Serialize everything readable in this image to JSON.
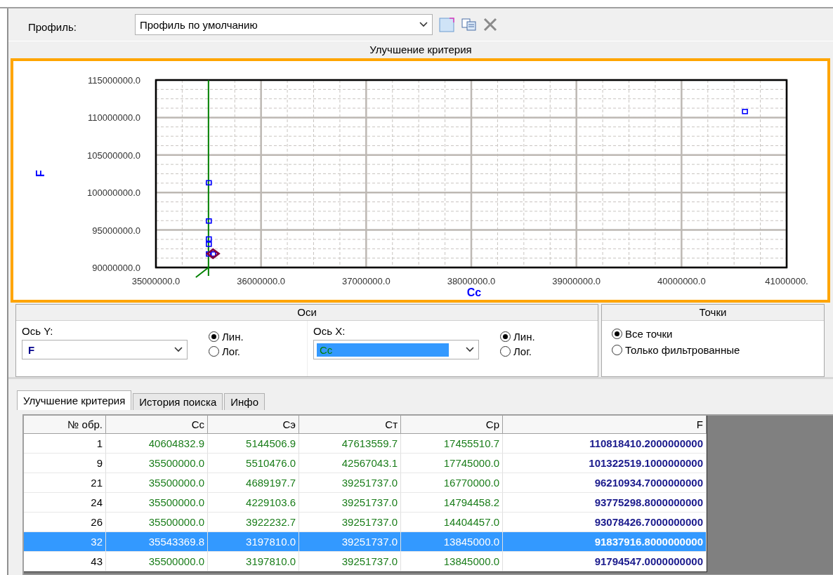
{
  "profile": {
    "label": "Профиль:",
    "value": "Профиль по умолчанию"
  },
  "chart_panel": {
    "title": "Улучшение критерия",
    "chart_data": {
      "type": "scatter",
      "xlabel": "Cc",
      "ylabel": "F",
      "xlim": [
        35000000,
        41000000
      ],
      "ylim": [
        90000000,
        115000000
      ],
      "xticks": [
        {
          "value": 35000000,
          "label": "35000000.0"
        },
        {
          "value": 36000000,
          "label": "36000000.0"
        },
        {
          "value": 37000000,
          "label": "37000000.0"
        },
        {
          "value": 38000000,
          "label": "38000000.0"
        },
        {
          "value": 39000000,
          "label": "39000000.0"
        },
        {
          "value": 40000000,
          "label": "40000000.0"
        },
        {
          "value": 41000000,
          "label": "41000000."
        }
      ],
      "yticks": [
        {
          "value": 90000000,
          "label": "90000000.0"
        },
        {
          "value": 95000000,
          "label": "95000000.0"
        },
        {
          "value": 100000000,
          "label": "100000000.0"
        },
        {
          "value": 105000000,
          "label": "105000000.0"
        },
        {
          "value": 110000000,
          "label": "110000000.0"
        },
        {
          "value": 115000000,
          "label": "115000000.0"
        }
      ],
      "series": [
        {
          "color": "#0000ff",
          "x": [
            40600000,
            35500000,
            35500000,
            35500000,
            35500000,
            35540000,
            35500000
          ],
          "values": [
            110800000,
            101300000,
            96200000,
            93800000,
            93100000,
            91800000,
            91800000
          ]
        }
      ],
      "grid": true,
      "ref_lines": [
        {
          "axis": "x",
          "value": 35500000
        }
      ]
    }
  },
  "axes_panel": {
    "title": "Оси",
    "axes": [
      {
        "label": "Ось Y:",
        "value": "F",
        "highlighted": false,
        "scales": [
          {
            "label": "Лин.",
            "selected": true
          },
          {
            "label": "Лог.",
            "selected": false
          }
        ]
      },
      {
        "label": "Ось X:",
        "value": "Cc",
        "highlighted": true,
        "scales": [
          {
            "label": "Лин.",
            "selected": true
          },
          {
            "label": "Лог.",
            "selected": false
          }
        ]
      }
    ]
  },
  "points_panel": {
    "title": "Точки",
    "options": [
      {
        "label": "Все точки",
        "selected": true
      },
      {
        "label": "Только фильтрованные",
        "selected": false
      }
    ]
  },
  "tabs": [
    {
      "label": "Улучшение критерия",
      "selected": true
    },
    {
      "label": "История поиска",
      "selected": false
    },
    {
      "label": "Инфо",
      "selected": false
    }
  ],
  "table": {
    "columns": [
      {
        "label": "№ обр.",
        "kind": "index"
      },
      {
        "label": "Cc",
        "kind": "param"
      },
      {
        "label": "Cэ",
        "kind": "param"
      },
      {
        "label": "Cт",
        "kind": "param"
      },
      {
        "label": "Cp",
        "kind": "param"
      },
      {
        "label": "F",
        "kind": "criterion"
      }
    ],
    "rows": [
      {
        "selected": false,
        "cells": [
          "1",
          "40604832.9",
          "5144506.9",
          "47613559.7",
          "17455510.7",
          "110818410.2000000000"
        ]
      },
      {
        "selected": false,
        "cells": [
          "9",
          "35500000.0",
          "5510476.0",
          "42567043.1",
          "17745000.0",
          "101322519.1000000000"
        ]
      },
      {
        "selected": false,
        "cells": [
          "21",
          "35500000.0",
          "4689197.7",
          "39251737.0",
          "16770000.0",
          "96210934.7000000000"
        ]
      },
      {
        "selected": false,
        "cells": [
          "24",
          "35500000.0",
          "4229103.6",
          "39251737.0",
          "14794458.2",
          "93775298.8000000000"
        ]
      },
      {
        "selected": false,
        "cells": [
          "26",
          "35500000.0",
          "3922232.7",
          "39251737.0",
          "14404457.0",
          "93078426.7000000000"
        ]
      },
      {
        "selected": true,
        "cells": [
          "32",
          "35543369.8",
          "3197810.0",
          "39251737.0",
          "13845000.0",
          "91837916.8000000000"
        ]
      },
      {
        "selected": false,
        "cells": [
          "43",
          "35500000.0",
          "3197810.0",
          "39251737.0",
          "13845000.0",
          "91794547.0000000000"
        ]
      }
    ]
  }
}
